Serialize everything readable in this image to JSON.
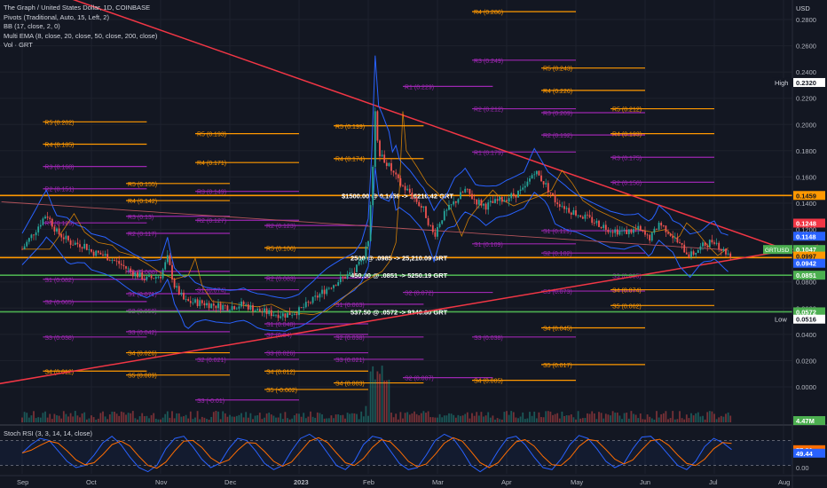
{
  "legend": {
    "title": "The Graph / United States Dollar, 1D, COINBASE",
    "pivots": "Pivots (Traditional, Auto, 15, Left, 2)",
    "bb": "BB (17, close, 2, 0)",
    "ema": "Multi EMA (8, close, 20, close, 50, close, 200, close)",
    "vol": "Vol · GRT"
  },
  "rsi_legend": "Stoch RSI (3, 3, 14, 14, close)",
  "currency": "USD",
  "colors": {
    "background": "#131722",
    "candle_up": "#26a69a",
    "candle_down": "#ef5350",
    "pivot_orange": "#ff9800",
    "pivot_purple": "#9c27b0",
    "trendline": "#f23645",
    "bb": "#2962ff",
    "green_line": "#4caf50",
    "rsi_k": "#2962ff",
    "rsi_d": "#ff6d00"
  },
  "chart_data": {
    "type": "candlestick",
    "ylim": [
      -0.01,
      0.28
    ],
    "y_scale": "linear",
    "yticks": [
      "0.2800",
      "0.2600",
      "0.2400",
      "0.2200",
      "0.2000",
      "0.1800",
      "0.1600",
      "0.1400",
      "0.1200",
      "0.1000",
      "0.0800",
      "0.0600",
      "0.0400",
      "0.0200",
      "0.0000"
    ],
    "x_labels": [
      {
        "label": "Sep",
        "month": 0
      },
      {
        "label": "Oct",
        "month": 1
      },
      {
        "label": "Nov",
        "month": 2
      },
      {
        "label": "Dec",
        "month": 3
      },
      {
        "label": "2023",
        "month": 4
      },
      {
        "label": "Feb",
        "month": 5
      },
      {
        "label": "Mar",
        "month": 6
      },
      {
        "label": "Apr",
        "month": 7
      },
      {
        "label": "May",
        "month": 8
      },
      {
        "label": "Jun",
        "month": 9
      },
      {
        "label": "Jul",
        "month": 10
      },
      {
        "label": "Aug",
        "month": 11
      }
    ],
    "price_tags": [
      {
        "text": "0.2320",
        "value": 0.232,
        "bg": "#ffffff",
        "fg": "#131722",
        "label": "High"
      },
      {
        "text": "0.1459",
        "value": 0.1459,
        "bg": "#ff9800",
        "fg": "#131722"
      },
      {
        "text": "0.1248",
        "value": 0.1248,
        "bg": "#f23645",
        "fg": "#ffffff"
      },
      {
        "text": "0.1148",
        "value": 0.1148,
        "bg": "#2962ff",
        "fg": "#ffffff"
      },
      {
        "text": "0.1047",
        "value": 0.1047,
        "bg": "#4caf50",
        "fg": "#ffffff"
      },
      {
        "text": "0.0997",
        "value": 0.0997,
        "bg": "#ff9800",
        "fg": "#131722"
      },
      {
        "text": "0.0942",
        "value": 0.0942,
        "bg": "#2962ff",
        "fg": "#ffffff"
      },
      {
        "text": "0.0851",
        "value": 0.0851,
        "bg": "#4caf50",
        "fg": "#ffffff"
      },
      {
        "text": "0.0572",
        "value": 0.0572,
        "bg": "#4caf50",
        "fg": "#ffffff"
      },
      {
        "text": "0.0516",
        "value": 0.0516,
        "bg": "#ffffff",
        "fg": "#131722",
        "label": "Low"
      },
      {
        "text": "4.47M",
        "value": -0.0068,
        "bg": "#4caf50",
        "fg": "#ffffff"
      }
    ],
    "symbol_tag": "GRTUSD",
    "horizontal_lines": [
      {
        "value": 0.1459,
        "color": "#ff9800",
        "text": "$1500.00 @ 0.1459 -> 10216.42  GRT"
      },
      {
        "value": 0.0985,
        "color": "#ff9800",
        "text": "2500 @ .0985 -> 25,210.09 GRT"
      },
      {
        "value": 0.0851,
        "color": "#4caf50",
        "text": "450.00 @ .0851 -> 5250.19  GRT"
      },
      {
        "value": 0.0572,
        "color": "#4caf50",
        "text": "537.50 @ .0572 -> 9340.80 GRT"
      }
    ],
    "pivots": [
      {
        "label": "R4 (0.286)",
        "value": 0.286,
        "color": "orange",
        "m0": 6.5,
        "m1": 8.0
      },
      {
        "label": "R3 (0.249)",
        "value": 0.249,
        "color": "purple",
        "m0": 6.5,
        "m1": 8.0
      },
      {
        "label": "R5 (0.243)",
        "value": 0.243,
        "color": "orange",
        "m0": 7.5,
        "m1": 9.0
      },
      {
        "label": "R4 (0.226)",
        "value": 0.226,
        "color": "orange",
        "m0": 7.5,
        "m1": 9.0
      },
      {
        "label": "R1 (0.229)",
        "value": 0.229,
        "color": "purple",
        "m0": 5.5,
        "m1": 6.8
      },
      {
        "label": "R2 (0.212)",
        "value": 0.212,
        "color": "purple",
        "m0": 6.5,
        "m1": 8.0
      },
      {
        "label": "R3 (0.209)",
        "value": 0.209,
        "color": "purple",
        "m0": 7.5,
        "m1": 9.0
      },
      {
        "label": "R5 (0.212)",
        "value": 0.212,
        "color": "orange",
        "m0": 8.5,
        "m1": 10.0
      },
      {
        "label": "R5 (0.202)",
        "value": 0.202,
        "color": "orange",
        "m0": 0.3,
        "m1": 1.8
      },
      {
        "label": "R5 (0.199)",
        "value": 0.199,
        "color": "orange",
        "m0": 4.5,
        "m1": 5.8
      },
      {
        "label": "R5 (0.193)",
        "value": 0.193,
        "color": "orange",
        "m0": 2.5,
        "m1": 4.0
      },
      {
        "label": "R2 (0.192)",
        "value": 0.192,
        "color": "purple",
        "m0": 7.5,
        "m1": 9.0
      },
      {
        "label": "R4 (0.193)",
        "value": 0.193,
        "color": "orange",
        "m0": 8.5,
        "m1": 10.0
      },
      {
        "label": "R4 (0.185)",
        "value": 0.185,
        "color": "orange",
        "m0": 0.3,
        "m1": 1.8
      },
      {
        "label": "R1 (0.179)",
        "value": 0.179,
        "color": "purple",
        "m0": 6.5,
        "m1": 8.0
      },
      {
        "label": "R4 (0.174)",
        "value": 0.174,
        "color": "orange",
        "m0": 4.5,
        "m1": 5.8
      },
      {
        "label": "R3 (0.175)",
        "value": 0.175,
        "color": "purple",
        "m0": 8.5,
        "m1": 10.0
      },
      {
        "label": "R4 (0.171)",
        "value": 0.171,
        "color": "orange",
        "m0": 2.5,
        "m1": 4.0
      },
      {
        "label": "R3 (0.168)",
        "value": 0.168,
        "color": "purple",
        "m0": 0.3,
        "m1": 1.8
      },
      {
        "label": "R2 (0.156)",
        "value": 0.156,
        "color": "purple",
        "m0": 8.5,
        "m1": 10.0
      },
      {
        "label": "R5 (0.155)",
        "value": 0.155,
        "color": "orange",
        "m0": 1.5,
        "m1": 3.0
      },
      {
        "label": "R2 (0.151)",
        "value": 0.151,
        "color": "purple",
        "m0": 0.3,
        "m1": 1.8
      },
      {
        "label": "R3 (0.149)",
        "value": 0.149,
        "color": "purple",
        "m0": 2.5,
        "m1": 4.0
      },
      {
        "label": "R4 (0.142)",
        "value": 0.142,
        "color": "orange",
        "m0": 1.5,
        "m1": 3.0
      },
      {
        "label": "R3 (0.13)",
        "value": 0.13,
        "color": "purple",
        "m0": 1.5,
        "m1": 3.0
      },
      {
        "label": "R2 (0.127)",
        "value": 0.127,
        "color": "purple",
        "m0": 2.5,
        "m1": 4.0
      },
      {
        "label": "R1 (0.125)",
        "value": 0.125,
        "color": "purple",
        "m0": 0.3,
        "m1": 1.8
      },
      {
        "label": "R2 (0.123)",
        "value": 0.123,
        "color": "purple",
        "m0": 3.5,
        "m1": 5.0
      },
      {
        "label": "S1 (0.119)",
        "value": 0.119,
        "color": "purple",
        "m0": 7.5,
        "m1": 9.0
      },
      {
        "label": "R2 (0.117)",
        "value": 0.117,
        "color": "purple",
        "m0": 1.5,
        "m1": 3.0
      },
      {
        "label": "S1 (0.109)",
        "value": 0.109,
        "color": "purple",
        "m0": 6.5,
        "m1": 8.0
      },
      {
        "label": "R5 (0.106)",
        "value": 0.106,
        "color": "orange",
        "m0": 3.5,
        "m1": 5.0
      },
      {
        "label": "S2 (0.102)",
        "value": 0.102,
        "color": "purple",
        "m0": 7.5,
        "m1": 9.0
      },
      {
        "label": "R1 (0.088)",
        "value": 0.088,
        "color": "purple",
        "m0": 1.5,
        "m1": 3.0
      },
      {
        "label": "S1 (0.082)",
        "value": 0.082,
        "color": "purple",
        "m0": 0.3,
        "m1": 1.8
      },
      {
        "label": "R2 (0.083)",
        "value": 0.083,
        "color": "purple",
        "m0": 3.5,
        "m1": 5.0
      },
      {
        "label": "S3 (0.085)",
        "value": 0.085,
        "color": "purple",
        "m0": 8.5,
        "m1": 10.0
      },
      {
        "label": "S1 (0.074)",
        "value": 0.074,
        "color": "purple",
        "m0": 2.5,
        "m1": 4.0
      },
      {
        "label": "S3 (0.073)",
        "value": 0.073,
        "color": "purple",
        "m0": 7.5,
        "m1": 9.0
      },
      {
        "label": "S4 (0.074)",
        "value": 0.074,
        "color": "orange",
        "m0": 8.5,
        "m1": 10.0
      },
      {
        "label": "S1 (0.071)",
        "value": 0.071,
        "color": "purple",
        "m0": 1.5,
        "m1": 3.0
      },
      {
        "label": "S2 (0.072)",
        "value": 0.072,
        "color": "purple",
        "m0": 5.5,
        "m1": 6.8
      },
      {
        "label": "S2 (0.065)",
        "value": 0.065,
        "color": "purple",
        "m0": 0.3,
        "m1": 1.8
      },
      {
        "label": "S1 (0.063)",
        "value": 0.063,
        "color": "purple",
        "m0": 4.5,
        "m1": 5.8
      },
      {
        "label": "S5 (0.062)",
        "value": 0.062,
        "color": "orange",
        "m0": 8.5,
        "m1": 10.0
      },
      {
        "label": "S2 (0.058)",
        "value": 0.058,
        "color": "purple",
        "m0": 1.5,
        "m1": 3.0
      },
      {
        "label": "S1 (0.048)",
        "value": 0.048,
        "color": "purple",
        "m0": 3.5,
        "m1": 5.0
      },
      {
        "label": "S4 (0.045)",
        "value": 0.045,
        "color": "orange",
        "m0": 7.5,
        "m1": 9.0
      },
      {
        "label": "S3 (0.042)",
        "value": 0.042,
        "color": "purple",
        "m0": 1.5,
        "m1": 3.0
      },
      {
        "label": "S2 (0.04)",
        "value": 0.04,
        "color": "purple",
        "m0": 3.5,
        "m1": 5.0
      },
      {
        "label": "S3 (0.038)",
        "value": 0.038,
        "color": "purple",
        "m0": 0.3,
        "m1": 1.8
      },
      {
        "label": "S2 (0.038)",
        "value": 0.038,
        "color": "purple",
        "m0": 4.5,
        "m1": 5.8
      },
      {
        "label": "S3 (0.038)",
        "value": 0.038,
        "color": "purple",
        "m0": 6.5,
        "m1": 8.0
      },
      {
        "label": "S4 (0.026)",
        "value": 0.026,
        "color": "orange",
        "m0": 1.5,
        "m1": 3.0
      },
      {
        "label": "S3 (0.026)",
        "value": 0.026,
        "color": "purple",
        "m0": 3.5,
        "m1": 5.0
      },
      {
        "label": "S2 (0.021)",
        "value": 0.021,
        "color": "purple",
        "m0": 2.5,
        "m1": 4.0
      },
      {
        "label": "S3 (0.021)",
        "value": 0.021,
        "color": "purple",
        "m0": 4.5,
        "m1": 5.8
      },
      {
        "label": "S5 (0.017)",
        "value": 0.017,
        "color": "orange",
        "m0": 7.5,
        "m1": 9.0
      },
      {
        "label": "S4 (0.012)",
        "value": 0.012,
        "color": "orange",
        "m0": 0.3,
        "m1": 1.8
      },
      {
        "label": "S4 (0.012)",
        "value": 0.012,
        "color": "orange",
        "m0": 3.5,
        "m1": 5.0
      },
      {
        "label": "S5 (0.009)",
        "value": 0.009,
        "color": "orange",
        "m0": 1.5,
        "m1": 3.0
      },
      {
        "label": "S2 (0.007)",
        "value": 0.007,
        "color": "purple",
        "m0": 5.5,
        "m1": 6.8
      },
      {
        "label": "S4 (0.005)",
        "value": 0.005,
        "color": "orange",
        "m0": 6.5,
        "m1": 8.0
      },
      {
        "label": "S4 (0.003)",
        "value": 0.003,
        "color": "orange",
        "m0": 4.5,
        "m1": 5.8
      },
      {
        "label": "S5 (-0.002)",
        "value": -0.002,
        "color": "orange",
        "m0": 3.5,
        "m1": 5.0
      },
      {
        "label": "S3 (-0.01)",
        "value": -0.01,
        "color": "purple",
        "m0": 2.5,
        "m1": 4.0
      }
    ],
    "trendlines": [
      {
        "from": [
          -0.6,
          0.32
        ],
        "to": [
          11.5,
          0.096
        ]
      },
      {
        "from": [
          -0.6,
          0.0
        ],
        "to": [
          11.5,
          0.108
        ]
      }
    ],
    "price_path": [
      [
        0.0,
        0.105
      ],
      [
        0.2,
        0.12
      ],
      [
        0.35,
        0.132
      ],
      [
        0.5,
        0.118
      ],
      [
        0.7,
        0.11
      ],
      [
        0.9,
        0.108
      ],
      [
        1.0,
        0.103
      ],
      [
        1.2,
        0.1
      ],
      [
        1.4,
        0.094
      ],
      [
        1.6,
        0.087
      ],
      [
        1.8,
        0.082
      ],
      [
        2.0,
        0.085
      ],
      [
        2.1,
        0.098
      ],
      [
        2.2,
        0.077
      ],
      [
        2.35,
        0.065
      ],
      [
        2.6,
        0.064
      ],
      [
        2.8,
        0.062
      ],
      [
        3.0,
        0.061
      ],
      [
        3.2,
        0.063
      ],
      [
        3.4,
        0.058
      ],
      [
        3.6,
        0.056
      ],
      [
        3.8,
        0.055
      ],
      [
        4.0,
        0.058
      ],
      [
        4.2,
        0.066
      ],
      [
        4.4,
        0.075
      ],
      [
        4.6,
        0.082
      ],
      [
        4.8,
        0.088
      ],
      [
        4.9,
        0.095
      ],
      [
        5.0,
        0.11
      ],
      [
        5.05,
        0.15
      ],
      [
        5.1,
        0.21
      ],
      [
        5.15,
        0.18
      ],
      [
        5.3,
        0.168
      ],
      [
        5.45,
        0.155
      ],
      [
        5.6,
        0.148
      ],
      [
        5.8,
        0.135
      ],
      [
        5.95,
        0.115
      ],
      [
        6.05,
        0.128
      ],
      [
        6.2,
        0.138
      ],
      [
        6.4,
        0.15
      ],
      [
        6.55,
        0.142
      ],
      [
        6.7,
        0.138
      ],
      [
        6.9,
        0.142
      ],
      [
        7.05,
        0.145
      ],
      [
        7.25,
        0.15
      ],
      [
        7.4,
        0.165
      ],
      [
        7.55,
        0.155
      ],
      [
        7.7,
        0.142
      ],
      [
        7.9,
        0.135
      ],
      [
        8.1,
        0.13
      ],
      [
        8.3,
        0.125
      ],
      [
        8.5,
        0.12
      ],
      [
        8.7,
        0.118
      ],
      [
        8.9,
        0.12
      ],
      [
        9.05,
        0.113
      ],
      [
        9.1,
        0.115
      ],
      [
        9.2,
        0.125
      ],
      [
        9.35,
        0.118
      ],
      [
        9.5,
        0.108
      ],
      [
        9.65,
        0.1
      ],
      [
        9.85,
        0.108
      ],
      [
        10.0,
        0.112
      ],
      [
        10.1,
        0.105
      ],
      [
        10.25,
        0.1
      ]
    ],
    "volume_note": "Vol bars shown beneath price; last volume 4.47M",
    "stoch_rsi": {
      "ylim": [
        0,
        100
      ],
      "yticks": [
        "49.44",
        "0.00"
      ],
      "k_last": 57.81,
      "d_last": 49.44,
      "k": [
        50,
        70,
        85,
        80,
        55,
        30,
        15,
        20,
        45,
        75,
        90,
        70,
        40,
        15,
        5,
        20,
        60,
        85,
        90,
        65,
        35,
        15,
        25,
        60,
        85,
        80,
        55,
        25,
        10,
        20,
        55,
        85,
        95,
        80,
        50,
        20,
        10,
        30,
        70,
        90,
        85,
        55,
        25,
        10,
        15,
        45,
        80,
        95,
        85,
        55,
        20,
        5,
        20,
        55,
        85,
        90,
        70,
        40,
        15,
        10,
        35,
        70,
        92,
        85,
        60,
        30,
        15,
        25,
        60,
        88,
        90,
        70,
        45,
        20,
        10,
        30,
        65,
        85,
        75,
        58
      ]
    }
  }
}
